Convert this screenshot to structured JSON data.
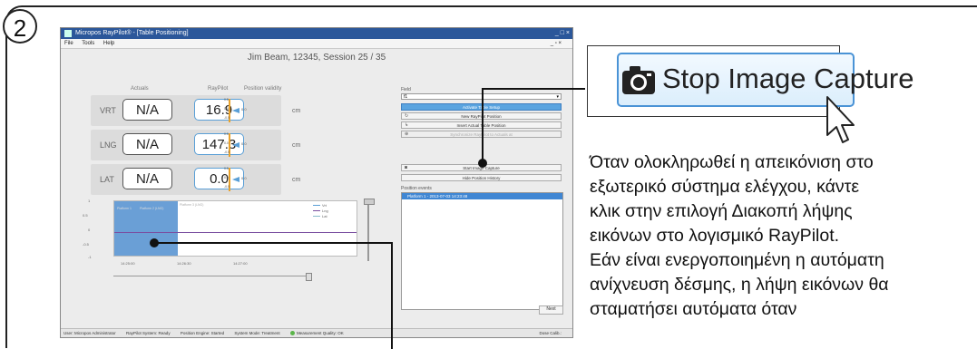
{
  "step_number": "2",
  "app": {
    "title": "Micropos RayPilot® - [Table Positioning]",
    "menu": [
      "File",
      "Tools",
      "Help"
    ],
    "window_buttons": "_ □ ×",
    "menu_right": "_ ฅ ×",
    "session": "Jim Beam, 12345, Session 25 / 35",
    "headers": {
      "actuals": "Actuals",
      "raypilot": "RayPilot",
      "validity": "Position validity"
    },
    "rows": [
      {
        "axis": "VRT",
        "actual": "N/A",
        "raypilot": "16.9",
        "unit": "cm"
      },
      {
        "axis": "LNG",
        "actual": "N/A",
        "raypilot": "147.3",
        "unit": "cm"
      },
      {
        "axis": "LAT",
        "actual": "N/A",
        "raypilot": "0.0",
        "unit": "cm"
      }
    ],
    "gauge_ticks": [
      "0.5",
      "0.0",
      "-0.5"
    ],
    "gauge_value": "0.0",
    "field_label": "Field",
    "field_value": "f1",
    "buttons": [
      {
        "label": "Activate Table Setup",
        "state": "active"
      },
      {
        "label": "New RayPilot Position",
        "state": "normal"
      },
      {
        "label": "Insert Actual Table Position",
        "state": "normal"
      },
      {
        "label": "Synchronize RayPilot to Actuals at",
        "state": "disabled"
      }
    ],
    "capture_button": "Start Image Capture",
    "history_button": "Hide Position History",
    "events_label": "Position events",
    "event_row": "Platform 1 - 2013-07-03 14:23:48",
    "graph": {
      "y_ticks": [
        "1",
        "0.5",
        "0",
        "-0.5",
        "-1"
      ],
      "x_ticks": [
        "14:25:00",
        "14:26:30",
        "14:27:00"
      ],
      "legend": [
        "Vrt",
        "Lng",
        "Lat"
      ],
      "markers": [
        "Platform 1",
        "Platform 2 (LNG)",
        "Platform 3 (LNG)"
      ]
    },
    "next_button": "Next",
    "status": {
      "user": "User: Micropos Administrator",
      "system": "RayPilot System: Ready",
      "engine": "Position Engine: Started",
      "mode": "System Mode: Treatment",
      "quality": "Measurement Quality: OK",
      "dose": "Dose Calib.:"
    }
  },
  "callout": {
    "label": "Stop Image Capture"
  },
  "description": [
    "Όταν ολοκληρωθεί η απεικόνιση στο",
    "εξωτερικό σύστημα ελέγχου, κάντε",
    "κλικ στην επιλογή Διακοπή λήψης",
    "εικόνων στο λογισμικό RayPilot.",
    "Εάν είναι ενεργοποιημένη η αυτόματη",
    "ανίχνευση δέσμης, η λήψη εικόνων θα",
    "σταματήσει αυτόματα όταν"
  ],
  "colors": {
    "accent": "#4a93d6",
    "active_button": "#5aa4e0",
    "selection": "#6a9fd6",
    "gauge": "#e8a12b"
  }
}
